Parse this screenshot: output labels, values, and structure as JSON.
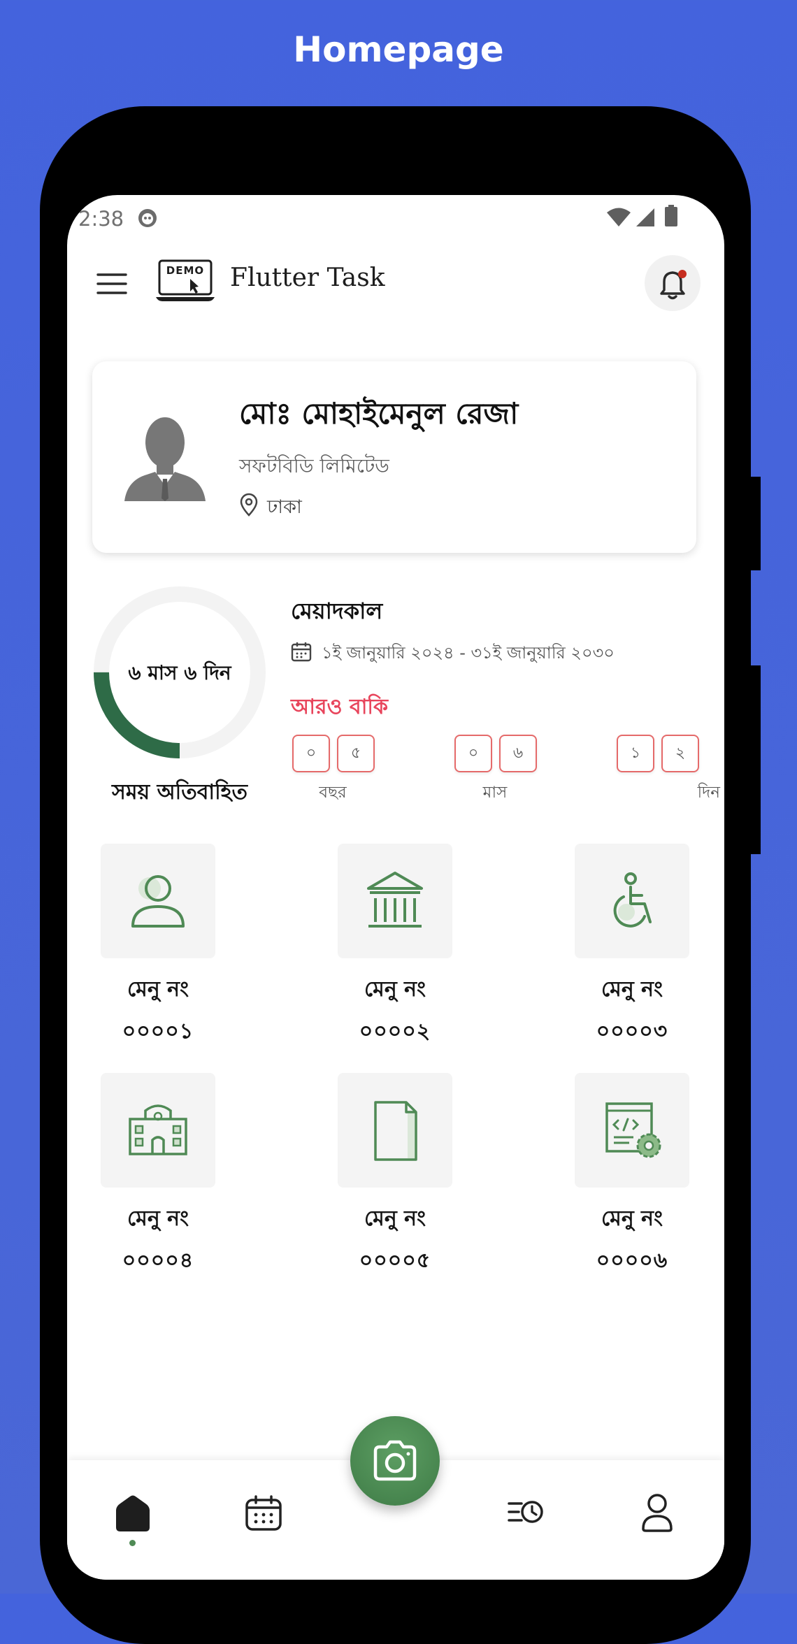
{
  "page_title": "Homepage",
  "status_bar": {
    "time": "2:38"
  },
  "app_bar": {
    "logo_text": "DEMO",
    "title": "Flutter Task"
  },
  "profile": {
    "name": "মোঃ মোহাইমেনুল রেজা",
    "company": "সফটবিডি লিমিটেড",
    "location": "ঢাকা"
  },
  "progress": {
    "center_text": "৬ মাস ৬ দিন",
    "caption": "সময় অতিবাহিত",
    "fraction": 0.25,
    "track_color": "#f3f3f3",
    "fill_color": "#2e6b47"
  },
  "period": {
    "title": "মেয়াদকাল",
    "date_range": "১ই জানুয়ারি ২০২৪ - ৩১ই জানুয়ারি ২০৩০",
    "remaining_label": "আরও বাকি",
    "remaining_color": "#e8455c",
    "units": [
      {
        "digits": [
          "০",
          "৫"
        ],
        "label": "বছর"
      },
      {
        "digits": [
          "০",
          "৬"
        ],
        "label": "মাস"
      },
      {
        "digits": [
          "১",
          "২"
        ],
        "label": "দিন"
      }
    ]
  },
  "menu": [
    {
      "label": "মেনু নং",
      "code": "০০০০১",
      "icon": "user-icon"
    },
    {
      "label": "মেনু নং",
      "code": "০০০০২",
      "icon": "bank-icon"
    },
    {
      "label": "মেনু নং",
      "code": "০০০০৩",
      "icon": "wheelchair-icon"
    },
    {
      "label": "মেনু নং",
      "code": "০০০০৪",
      "icon": "school-building-icon"
    },
    {
      "label": "মেনু নং",
      "code": "০০০০৫",
      "icon": "document-icon"
    },
    {
      "label": "মেনু নং",
      "code": "০০০০৬",
      "icon": "code-settings-icon"
    }
  ],
  "bottom_nav": {
    "items": [
      "home-icon",
      "calendar-icon",
      "camera-icon",
      "history-icon",
      "profile-icon"
    ],
    "active": "home-icon"
  },
  "colors": {
    "background": "#4463dd",
    "accent_green": "#4f8a55",
    "alert_red": "#e8455c"
  }
}
